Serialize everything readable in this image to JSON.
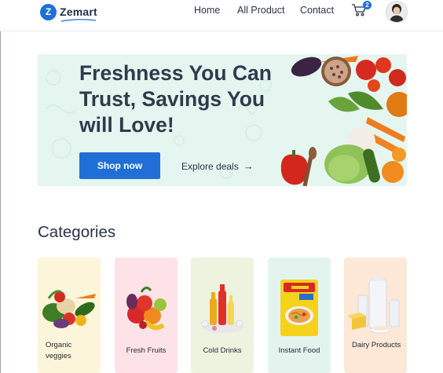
{
  "header": {
    "brand": "Zemart",
    "brand_mark": "Z",
    "nav": [
      {
        "label": "Home"
      },
      {
        "label": "All Product"
      },
      {
        "label": "Contact"
      }
    ],
    "cart_count": "2",
    "icons": {
      "cart": "cart-icon",
      "avatar": "user-avatar"
    }
  },
  "hero": {
    "title": "Freshness You Can Trust, Savings You will Love!",
    "primary_button": "Shop now",
    "secondary_link": "Explore deals",
    "secondary_arrow": "→",
    "colors": {
      "background": "#e4f6ef",
      "button": "#1f6fd6"
    }
  },
  "categories": {
    "title": "Categories",
    "items": [
      {
        "label": "Organic veggies",
        "bg": "#fdf5d9"
      },
      {
        "label": "Fresh Fruits",
        "bg": "#fde3e7"
      },
      {
        "label": "Cold Drinks",
        "bg": "#eef3e0"
      },
      {
        "label": "Instant Food",
        "bg": "#e3f4ee"
      },
      {
        "label": "Dairy Products",
        "bg": "#fde7d6"
      }
    ]
  },
  "accent_color": "#1f6fd6"
}
